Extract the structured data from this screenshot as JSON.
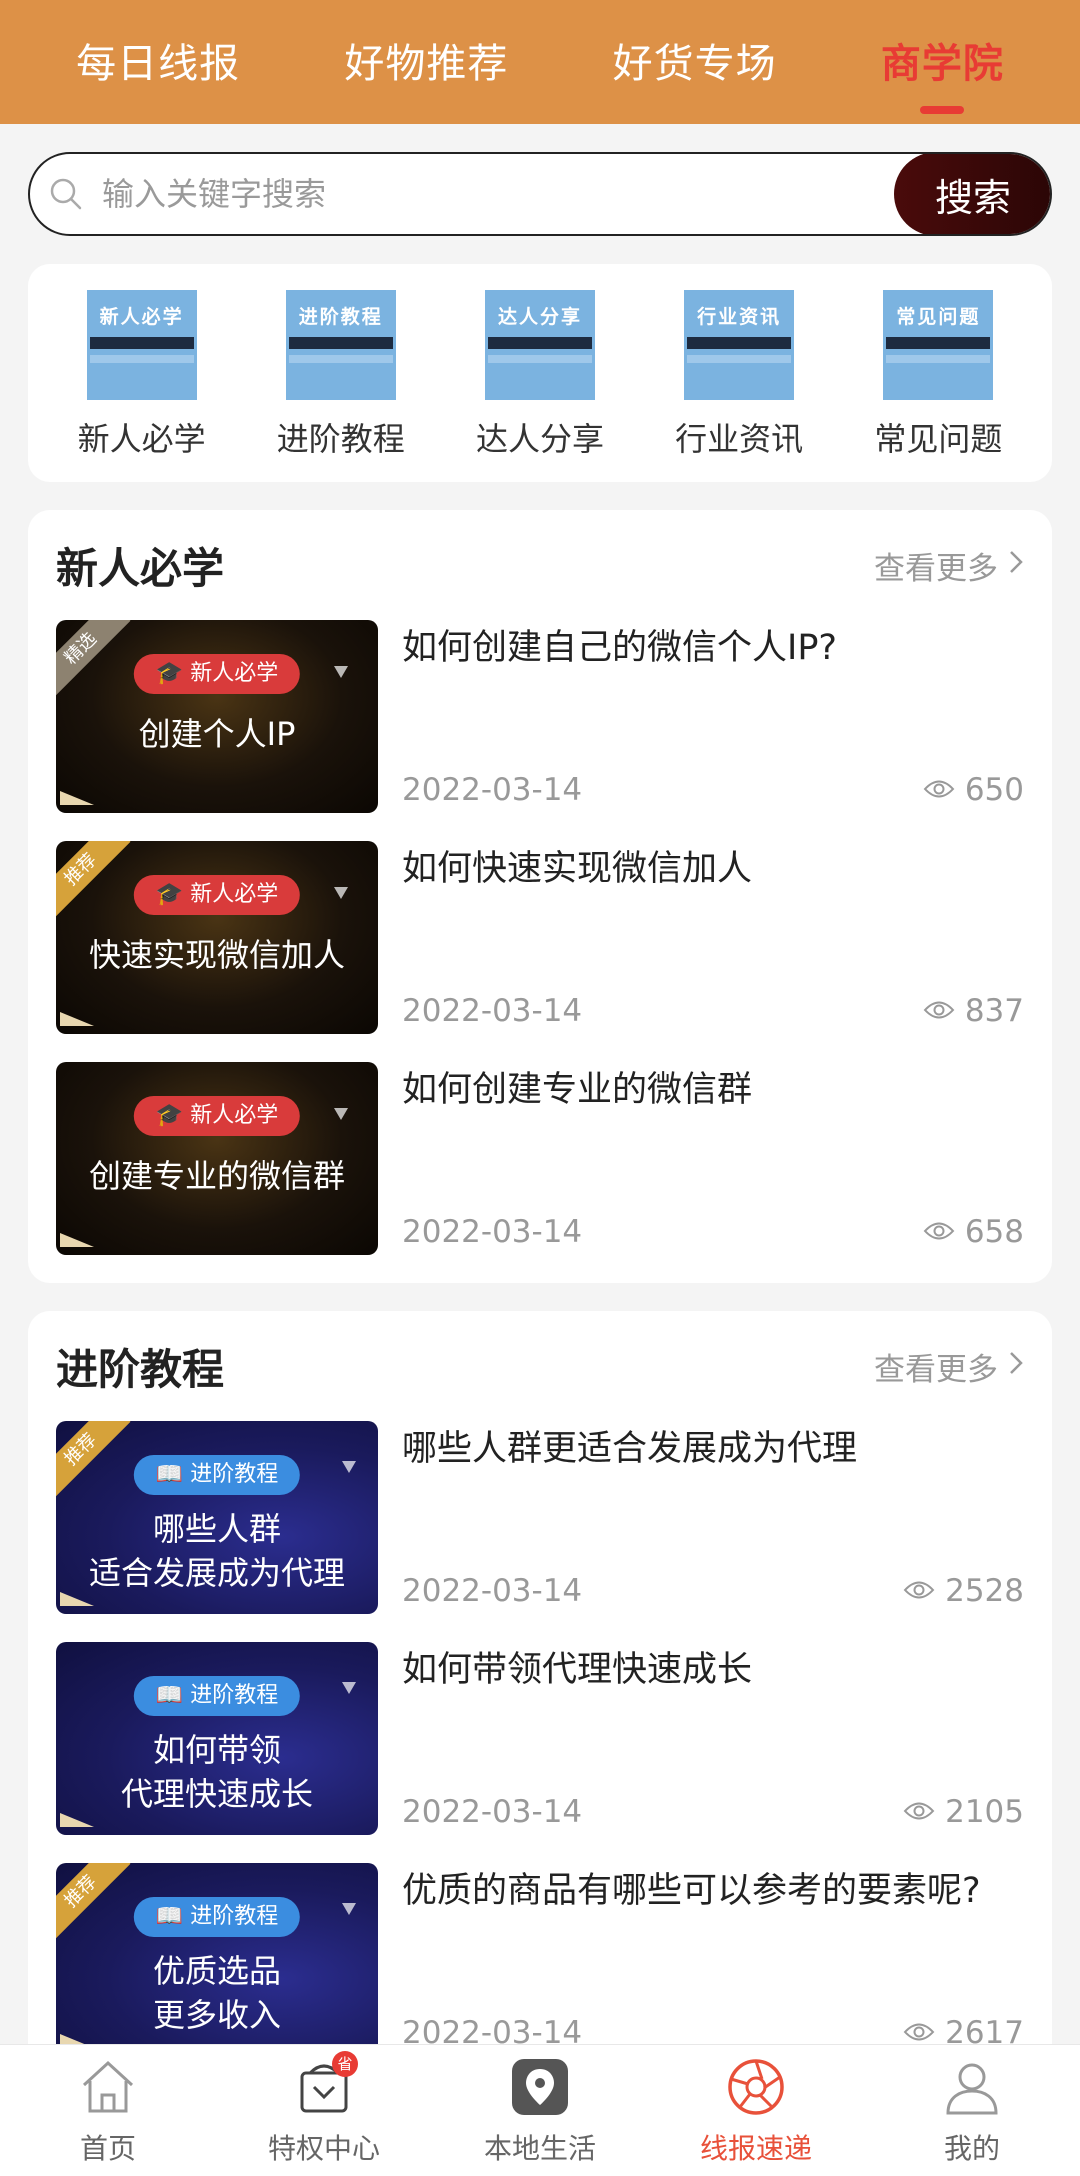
{
  "top_tabs": [
    {
      "label": "每日线报"
    },
    {
      "label": "好物推荐"
    },
    {
      "label": "好货专场"
    },
    {
      "label": "商学院"
    }
  ],
  "search": {
    "placeholder": "输入关键字搜索",
    "button": "搜索"
  },
  "categories": [
    {
      "label": "新人必学",
      "thumb_text": "新人必学"
    },
    {
      "label": "进阶教程",
      "thumb_text": "进阶教程"
    },
    {
      "label": "达人分享",
      "thumb_text": "达人分享"
    },
    {
      "label": "行业资讯",
      "thumb_text": "行业资讯"
    },
    {
      "label": "常见问题",
      "thumb_text": "常见问题"
    }
  ],
  "sections": [
    {
      "title": "新人必学",
      "more": "查看更多",
      "articles": [
        {
          "title": "如何创建自己的微信个人IP?",
          "date": "2022-03-14",
          "views": "650",
          "tag": "精选",
          "pill": "新人必学",
          "thumb_line1": "创建个人IP",
          "thumb_line2": ""
        },
        {
          "title": "如何快速实现微信加人",
          "date": "2022-03-14",
          "views": "837",
          "tag": "推荐",
          "pill": "新人必学",
          "thumb_line1": "快速实现微信加人",
          "thumb_line2": ""
        },
        {
          "title": "如何创建专业的微信群",
          "date": "2022-03-14",
          "views": "658",
          "tag": "",
          "pill": "新人必学",
          "thumb_line1": "创建专业的微信群",
          "thumb_line2": ""
        }
      ]
    },
    {
      "title": "进阶教程",
      "more": "查看更多",
      "articles": [
        {
          "title": "哪些人群更适合发展成为代理",
          "date": "2022-03-14",
          "views": "2528",
          "tag": "推荐",
          "pill": "进阶教程",
          "thumb_line1": "哪些人群",
          "thumb_line2": "适合发展成为代理"
        },
        {
          "title": "如何带领代理快速成长",
          "date": "2022-03-14",
          "views": "2105",
          "tag": "",
          "pill": "进阶教程",
          "thumb_line1": "如何带领",
          "thumb_line2": "代理快速成长"
        },
        {
          "title": "优质的商品有哪些可以参考的要素呢?",
          "date": "2022-03-14",
          "views": "2617",
          "tag": "推荐",
          "pill": "进阶教程",
          "thumb_line1": "优质选品",
          "thumb_line2": "更多收入"
        }
      ]
    }
  ],
  "bottom_nav": [
    {
      "label": "首页",
      "icon": "home-icon"
    },
    {
      "label": "特权中心",
      "icon": "privilege-icon",
      "badge": "省"
    },
    {
      "label": "本地生活",
      "icon": "local-life-icon"
    },
    {
      "label": "线报速递",
      "icon": "aperture-icon"
    },
    {
      "label": "我的",
      "icon": "user-icon"
    }
  ],
  "colors": {
    "header": "#dd9147",
    "accent": "#e83b34",
    "search_button": "#3a0808",
    "active_nav": "#e8513a"
  }
}
